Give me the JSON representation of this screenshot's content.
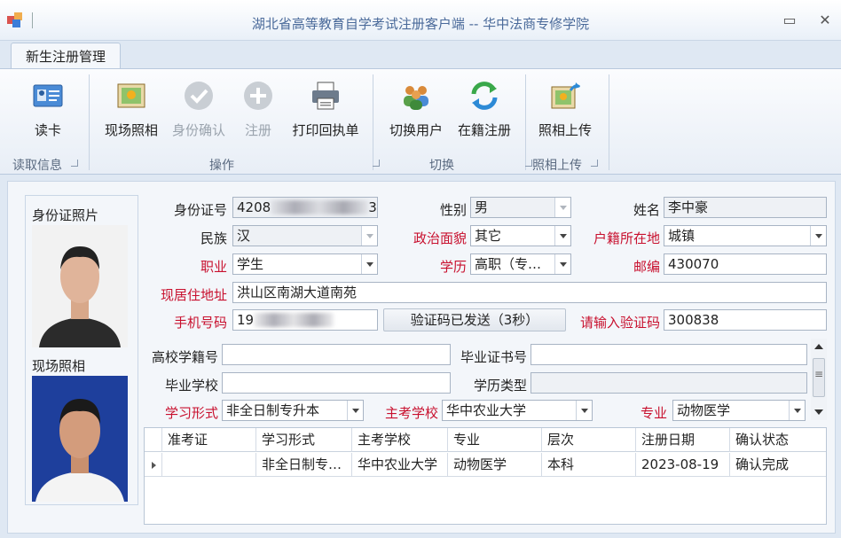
{
  "window": {
    "title": "湖北省高等教育自学考试注册客户端 -- 华中法商专修学院",
    "minimize_label": "▭",
    "close_label": "✕"
  },
  "tabs": [
    {
      "label": "新生注册管理"
    }
  ],
  "ribbon": {
    "buttons": {
      "read_card": "读卡",
      "photo": "现场照相",
      "id_confirm": "身份确认",
      "register": "注册",
      "print": "打印回执单",
      "switch_user": "切换用户",
      "enrolled_register": "在籍注册",
      "photo_upload": "照相上传"
    },
    "groups": {
      "read_info": "读取信息",
      "operation": "操作",
      "switch": "切换",
      "photo_upload": "照相上传"
    }
  },
  "photos": {
    "id_photo_label": "身份证照片",
    "scene_photo_label": "现场照相"
  },
  "form": {
    "labels": {
      "id_number": "身份证号",
      "gender": "性别",
      "name": "姓名",
      "ethnicity": "民族",
      "political": "政治面貌",
      "household": "户籍所在地",
      "occupation": "职业",
      "education": "学历",
      "postcode": "邮编",
      "address": "现居住地址",
      "phone": "手机号码",
      "verify_prompt": "请输入验证码",
      "college_no": "高校学籍号",
      "diploma_no": "毕业证书号",
      "grad_school": "毕业学校",
      "edu_type": "学历类型",
      "study_form": "学习形式",
      "main_school": "主考学校",
      "major": "专业"
    },
    "values": {
      "id_number_prefix": "4208",
      "id_number_suffix": "33",
      "gender": "男",
      "name": "李中豪",
      "ethnicity": "汉",
      "political": "其它",
      "household": "城镇",
      "occupation": "学生",
      "education": "高职（专…",
      "postcode": "430070",
      "address": "洪山区南湖大道南苑",
      "phone_prefix": "19",
      "send_code_button": "验证码已发送（3秒）",
      "verify_code": "300838",
      "college_no": "",
      "diploma_no": "",
      "grad_school": "",
      "edu_type": "",
      "study_form": "非全日制专升本",
      "main_school": "华中农业大学",
      "major": "动物医学"
    }
  },
  "table": {
    "columns": [
      "准考证",
      "学习形式",
      "主考学校",
      "专业",
      "层次",
      "注册日期",
      "确认状态"
    ],
    "rows": [
      [
        "",
        "非全日制专…",
        "华中农业大学",
        "动物医学",
        "本科",
        "2023-08-19",
        "确认完成"
      ]
    ]
  },
  "colors": {
    "required_label": "#c8102e",
    "title_text": "#4a6a9a"
  }
}
